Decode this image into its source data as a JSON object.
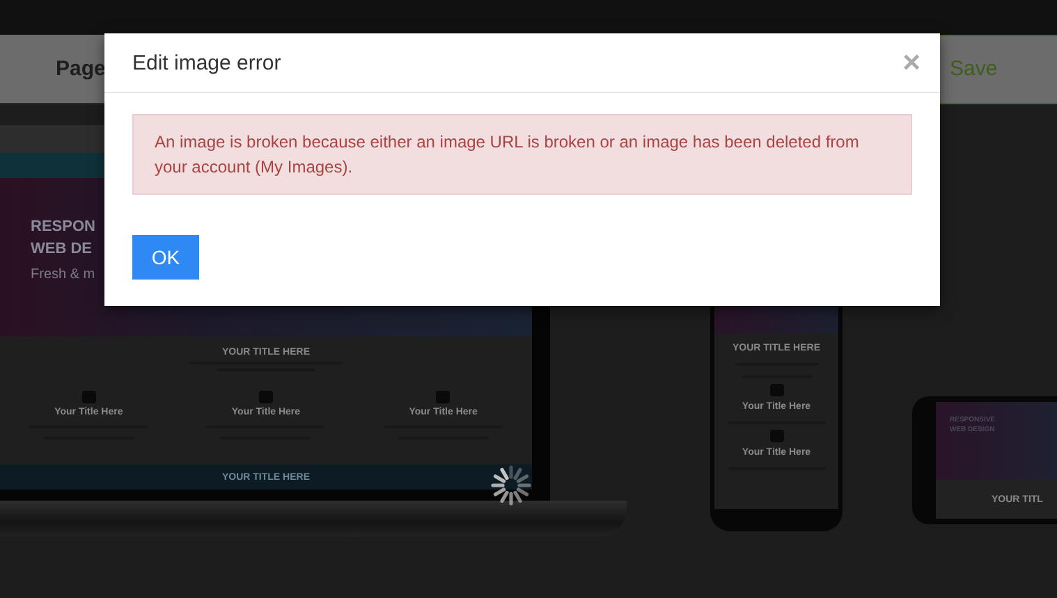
{
  "toolbar": {
    "page_label": "Page",
    "save_button": "Save"
  },
  "preview": {
    "laptop": {
      "hero_lines": [
        "RESPON",
        "WEB DE"
      ],
      "hero_subtitle": "Fresh & m",
      "section_title": "YOUR TITLE HERE",
      "features": [
        "Your Title Here",
        "Your Title Here",
        "Your Title Here"
      ],
      "footer_title": "YOUR TITLE HERE"
    },
    "phone": {
      "section_title": "YOUR TITLE HERE",
      "features": [
        "Your Title Here",
        "Your Title Here"
      ]
    },
    "tablet": {
      "hero_lines": [
        "RESPONSIVE",
        "WEB DESIGN"
      ],
      "section_title": "YOUR TITL"
    }
  },
  "dialog": {
    "title": "Edit image error",
    "close": "×",
    "alert": "An image is broken because either an image URL is broken or an image has been deleted from your account (My Images).",
    "ok_button": "OK"
  }
}
